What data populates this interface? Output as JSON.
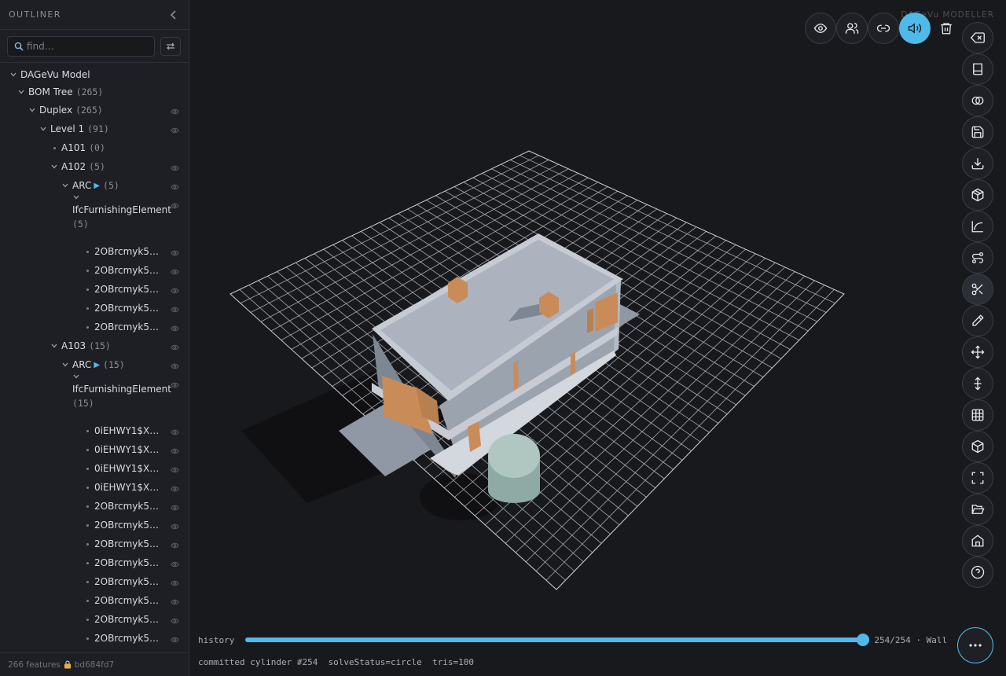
{
  "sidebar": {
    "title": "OUTLINER",
    "search_placeholder": "find…",
    "footer_features": "266 features",
    "footer_hash": "bd684fd7",
    "tree": [
      {
        "label": "DAGeVu Model",
        "count": "",
        "caret": true,
        "arrow": false,
        "eye": false
      },
      {
        "label": "BOM Tree",
        "count": "(265)",
        "caret": true,
        "arrow": false,
        "eye": false
      },
      {
        "label": "Duplex",
        "count": "(265)",
        "caret": true,
        "arrow": false,
        "eye": true
      },
      {
        "label": "Level 1",
        "count": "(91)",
        "caret": true,
        "arrow": false,
        "eye": true
      },
      {
        "label": "A101",
        "count": "(0)",
        "caret": false,
        "arrow": false,
        "eye": false
      },
      {
        "label": "A102",
        "count": "(5)",
        "caret": true,
        "arrow": false,
        "eye": true
      },
      {
        "label": "ARC",
        "count": "(5)",
        "caret": true,
        "arrow": true,
        "eye": true
      },
      {
        "label": "IfcFurnishingElement",
        "count": "(5)",
        "caret": true,
        "arrow": false,
        "eye": true
      },
      {
        "label": "2OBrcmyk58...",
        "count": "",
        "caret": false,
        "arrow": false,
        "eye": true
      },
      {
        "label": "2OBrcmyk58...",
        "count": "",
        "caret": false,
        "arrow": false,
        "eye": true
      },
      {
        "label": "2OBrcmyk58...",
        "count": "",
        "caret": false,
        "arrow": false,
        "eye": true
      },
      {
        "label": "2OBrcmyk58...",
        "count": "",
        "caret": false,
        "arrow": false,
        "eye": true
      },
      {
        "label": "2OBrcmyk58...",
        "count": "",
        "caret": false,
        "arrow": false,
        "eye": true
      },
      {
        "label": "A103",
        "count": "(15)",
        "caret": true,
        "arrow": false,
        "eye": true
      },
      {
        "label": "ARC",
        "count": "(15)",
        "caret": true,
        "arrow": true,
        "eye": true
      },
      {
        "label": "IfcFurnishingElement",
        "count": "(15)",
        "caret": true,
        "arrow": false,
        "eye": true
      },
      {
        "label": "0iEHWY1$XA...",
        "count": "",
        "caret": false,
        "arrow": false,
        "eye": true
      },
      {
        "label": "0iEHWY1$XA...",
        "count": "",
        "caret": false,
        "arrow": false,
        "eye": true
      },
      {
        "label": "0iEHWY1$XA...",
        "count": "",
        "caret": false,
        "arrow": false,
        "eye": true
      },
      {
        "label": "0iEHWY1$XA...",
        "count": "",
        "caret": false,
        "arrow": false,
        "eye": true
      },
      {
        "label": "2OBrcmyk58...",
        "count": "",
        "caret": false,
        "arrow": false,
        "eye": true
      },
      {
        "label": "2OBrcmyk58...",
        "count": "",
        "caret": false,
        "arrow": false,
        "eye": true
      },
      {
        "label": "2OBrcmyk58...",
        "count": "",
        "caret": false,
        "arrow": false,
        "eye": true
      },
      {
        "label": "2OBrcmyk58...",
        "count": "",
        "caret": false,
        "arrow": false,
        "eye": true
      },
      {
        "label": "2OBrcmyk58...",
        "count": "",
        "caret": false,
        "arrow": false,
        "eye": true
      },
      {
        "label": "2OBrcmyk58...",
        "count": "",
        "caret": false,
        "arrow": false,
        "eye": true
      },
      {
        "label": "2OBrcmyk58...",
        "count": "",
        "caret": false,
        "arrow": false,
        "eye": true
      },
      {
        "label": "2OBrcmyk58...",
        "count": "",
        "caret": false,
        "arrow": false,
        "eye": true
      }
    ]
  },
  "viewport": {
    "brand": "DAGeVu MODELLER",
    "top_tools": [
      "eye-icon",
      "users-icon",
      "link-icon",
      "volume-icon",
      "trash-icon"
    ],
    "right_tools": [
      "backspace-icon",
      "book-icon",
      "overlap-icon",
      "save-icon",
      "download-icon",
      "box-icon",
      "curve-icon",
      "route-icon",
      "scissors-icon",
      "pencil-icon",
      "move-icon",
      "vertical-move-icon",
      "grid-icon",
      "cube-icon",
      "fullscreen-icon",
      "folder-open-icon",
      "home-icon",
      "help-icon"
    ],
    "history_label": "history",
    "history_value": 254,
    "history_max": 254,
    "history_position": "254/254 · Wall",
    "status": "committed cylinder #254  solveStatus=circle  tris=100",
    "more_icon": "more-horizontal-icon"
  },
  "colors": {
    "accent": "#4fb9ea",
    "background": "#18191d",
    "sidebar": "#1d1f24",
    "building": "#a9b1bd",
    "wood": "#c98c58",
    "cylinder": "#9db7b1"
  }
}
